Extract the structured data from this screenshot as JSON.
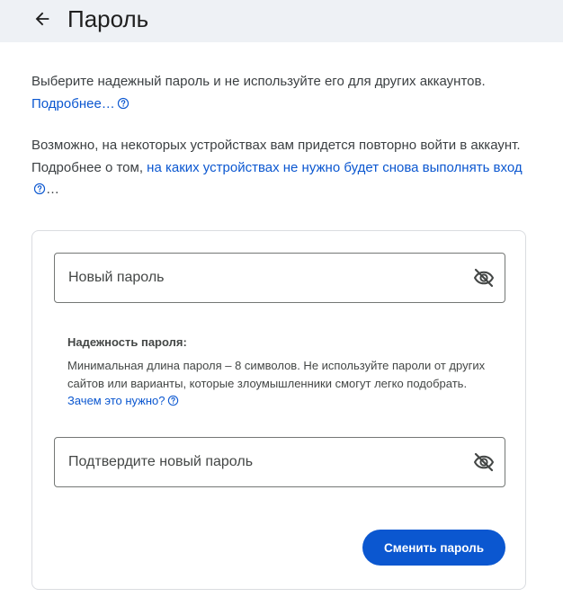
{
  "header": {
    "title": "Пароль",
    "back_icon": "arrow-back-icon"
  },
  "intro": {
    "text": "Выберите надежный пароль и не используйте его для других аккаунтов.",
    "link": "Подробнее…"
  },
  "devices": {
    "text": "Возможно, на некоторых устройствах вам придется повторно войти в аккаунт. Подробнее о том, ",
    "link": "на каких устройствах не нужно будет снова выполнять вход",
    "suffix": "…"
  },
  "form": {
    "new_password": {
      "placeholder": "Новый пароль",
      "value": "",
      "toggle_icon": "eye-off-icon"
    },
    "strength": {
      "title": "Надежность пароля:",
      "text": "Минимальная длина пароля – 8 символов. Не используйте пароли от других сайтов или варианты, которые злоумышленники смогут легко подобрать. ",
      "link": "Зачем это нужно?"
    },
    "confirm_password": {
      "placeholder": "Подтвердите новый пароль",
      "value": "",
      "toggle_icon": "eye-off-icon"
    },
    "submit_label": "Сменить пароль"
  },
  "colors": {
    "header_bg": "#eef1f5",
    "link": "#0b57d0",
    "primary_button": "#0b57d0",
    "card_border": "#dadce0"
  }
}
